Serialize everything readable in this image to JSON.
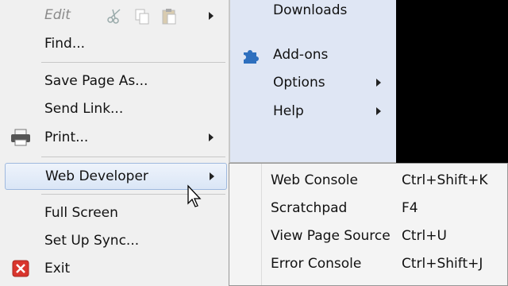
{
  "main_menu": {
    "edit_label": "Edit",
    "find_label": "Find...",
    "save_page_label": "Save Page As...",
    "send_link_label": "Send Link...",
    "print_label": "Print...",
    "web_developer_label": "Web Developer",
    "full_screen_label": "Full Screen",
    "set_up_sync_label": "Set Up Sync...",
    "exit_label": "Exit"
  },
  "right_menu": {
    "downloads_label": "Downloads",
    "addons_label": "Add-ons",
    "options_label": "Options",
    "help_label": "Help"
  },
  "web_developer_submenu": {
    "items": [
      {
        "label": "Web Console",
        "shortcut": "Ctrl+Shift+K"
      },
      {
        "label": "Scratchpad",
        "shortcut": "F4"
      },
      {
        "label": "View Page Source",
        "shortcut": "Ctrl+U"
      },
      {
        "label": "Error Console",
        "shortcut": "Ctrl+Shift+J"
      }
    ]
  },
  "icons": {
    "cut": "scissors-icon",
    "copy": "copy-icon",
    "paste": "paste-icon",
    "print": "printer-icon",
    "addons": "puzzle-piece-icon",
    "exit": "close-icon"
  },
  "colors": {
    "menu_background": "#f0f0f0",
    "right_panel_background": "#dfe6f4",
    "highlight": "#dae6f6",
    "exit_red": "#d9352d",
    "addons_blue": "#2e6fbe"
  }
}
